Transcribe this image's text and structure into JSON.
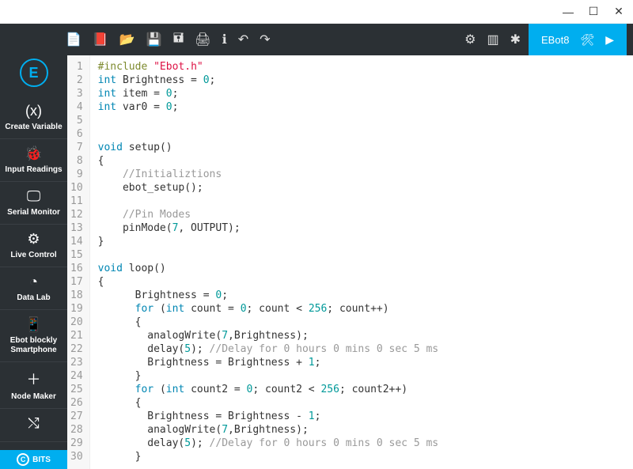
{
  "window": {
    "min": "—",
    "max": "☐",
    "close": "✕"
  },
  "toolbar": {
    "icons": [
      "📄",
      "📕",
      "📂",
      "💾",
      "🖬",
      "🖨",
      "ℹ",
      "↶",
      "↷"
    ],
    "right_icons": [
      "⚙",
      "▥",
      "✱"
    ]
  },
  "project": {
    "name": "EBot8",
    "tools_icon": "🛠",
    "play_icon": "▶"
  },
  "sidebar": {
    "logo": "E",
    "items": [
      {
        "icon": "(x)",
        "label": "Create Variable"
      },
      {
        "icon": "🐞",
        "label": "Input Readings"
      },
      {
        "icon": "🖵",
        "label": "Serial Monitor"
      },
      {
        "icon": "⚙",
        "label": "Live Control"
      },
      {
        "icon": "◔",
        "label": "Data Lab"
      },
      {
        "icon": "📱",
        "label": "Ebot blockly Smartphone"
      },
      {
        "icon": "＋",
        "label": "Node Maker"
      },
      {
        "icon": "⤭",
        "label": ""
      }
    ],
    "bottom": "BITS"
  },
  "code": {
    "lines": [
      [
        {
          "t": "#include ",
          "c": "kw-pre"
        },
        {
          "t": "\"Ebot.h\"",
          "c": "str"
        }
      ],
      [
        {
          "t": "int ",
          "c": "kw-type"
        },
        {
          "t": "Brightness = ",
          "c": "id"
        },
        {
          "t": "0",
          "c": "num"
        },
        {
          "t": ";",
          "c": "id"
        }
      ],
      [
        {
          "t": "int ",
          "c": "kw-type"
        },
        {
          "t": "item = ",
          "c": "id"
        },
        {
          "t": "0",
          "c": "num"
        },
        {
          "t": ";",
          "c": "id"
        }
      ],
      [
        {
          "t": "int ",
          "c": "kw-type"
        },
        {
          "t": "var0 = ",
          "c": "id"
        },
        {
          "t": "0",
          "c": "num"
        },
        {
          "t": ";",
          "c": "id"
        }
      ],
      [],
      [],
      [
        {
          "t": "void ",
          "c": "kw-void"
        },
        {
          "t": "setup",
          "c": "fn"
        },
        {
          "t": "()",
          "c": "id"
        }
      ],
      [
        {
          "t": "{",
          "c": "id"
        }
      ],
      [
        {
          "t": "    ",
          "c": "id"
        },
        {
          "t": "//Initializtions",
          "c": "cm"
        }
      ],
      [
        {
          "t": "    ebot_setup();",
          "c": "id"
        }
      ],
      [],
      [
        {
          "t": "    ",
          "c": "id"
        },
        {
          "t": "//Pin Modes",
          "c": "cm"
        }
      ],
      [
        {
          "t": "    pinMode(",
          "c": "id"
        },
        {
          "t": "7",
          "c": "num"
        },
        {
          "t": ", OUTPUT);",
          "c": "id"
        }
      ],
      [
        {
          "t": "}",
          "c": "id"
        }
      ],
      [],
      [
        {
          "t": "void ",
          "c": "kw-void"
        },
        {
          "t": "loop",
          "c": "fn"
        },
        {
          "t": "()",
          "c": "id"
        }
      ],
      [
        {
          "t": "{",
          "c": "id"
        }
      ],
      [
        {
          "t": "      Brightness = ",
          "c": "id"
        },
        {
          "t": "0",
          "c": "num"
        },
        {
          "t": ";",
          "c": "id"
        }
      ],
      [
        {
          "t": "      ",
          "c": "id"
        },
        {
          "t": "for ",
          "c": "kw-type"
        },
        {
          "t": "(",
          "c": "id"
        },
        {
          "t": "int ",
          "c": "kw-type"
        },
        {
          "t": "count = ",
          "c": "id"
        },
        {
          "t": "0",
          "c": "num"
        },
        {
          "t": "; count < ",
          "c": "id"
        },
        {
          "t": "256",
          "c": "num"
        },
        {
          "t": "; count++)",
          "c": "id"
        }
      ],
      [
        {
          "t": "      {",
          "c": "id"
        }
      ],
      [
        {
          "t": "        analogWrite(",
          "c": "id"
        },
        {
          "t": "7",
          "c": "num"
        },
        {
          "t": ",Brightness);",
          "c": "id"
        }
      ],
      [
        {
          "t": "        delay(",
          "c": "id"
        },
        {
          "t": "5",
          "c": "num"
        },
        {
          "t": "); ",
          "c": "id"
        },
        {
          "t": "//Delay for 0 hours 0 mins 0 sec 5 ms",
          "c": "cm"
        }
      ],
      [
        {
          "t": "        Brightness = Brightness + ",
          "c": "id"
        },
        {
          "t": "1",
          "c": "num"
        },
        {
          "t": ";",
          "c": "id"
        }
      ],
      [
        {
          "t": "      }",
          "c": "id"
        }
      ],
      [
        {
          "t": "      ",
          "c": "id"
        },
        {
          "t": "for ",
          "c": "kw-type"
        },
        {
          "t": "(",
          "c": "id"
        },
        {
          "t": "int ",
          "c": "kw-type"
        },
        {
          "t": "count2 = ",
          "c": "id"
        },
        {
          "t": "0",
          "c": "num"
        },
        {
          "t": "; count2 < ",
          "c": "id"
        },
        {
          "t": "256",
          "c": "num"
        },
        {
          "t": "; count2++)",
          "c": "id"
        }
      ],
      [
        {
          "t": "      {",
          "c": "id"
        }
      ],
      [
        {
          "t": "        Brightness = Brightness - ",
          "c": "id"
        },
        {
          "t": "1",
          "c": "num"
        },
        {
          "t": ";",
          "c": "id"
        }
      ],
      [
        {
          "t": "        analogWrite(",
          "c": "id"
        },
        {
          "t": "7",
          "c": "num"
        },
        {
          "t": ",Brightness);",
          "c": "id"
        }
      ],
      [
        {
          "t": "        delay(",
          "c": "id"
        },
        {
          "t": "5",
          "c": "num"
        },
        {
          "t": "); ",
          "c": "id"
        },
        {
          "t": "//Delay for 0 hours 0 mins 0 sec 5 ms",
          "c": "cm"
        }
      ],
      [
        {
          "t": "      }",
          "c": "id"
        }
      ]
    ]
  }
}
